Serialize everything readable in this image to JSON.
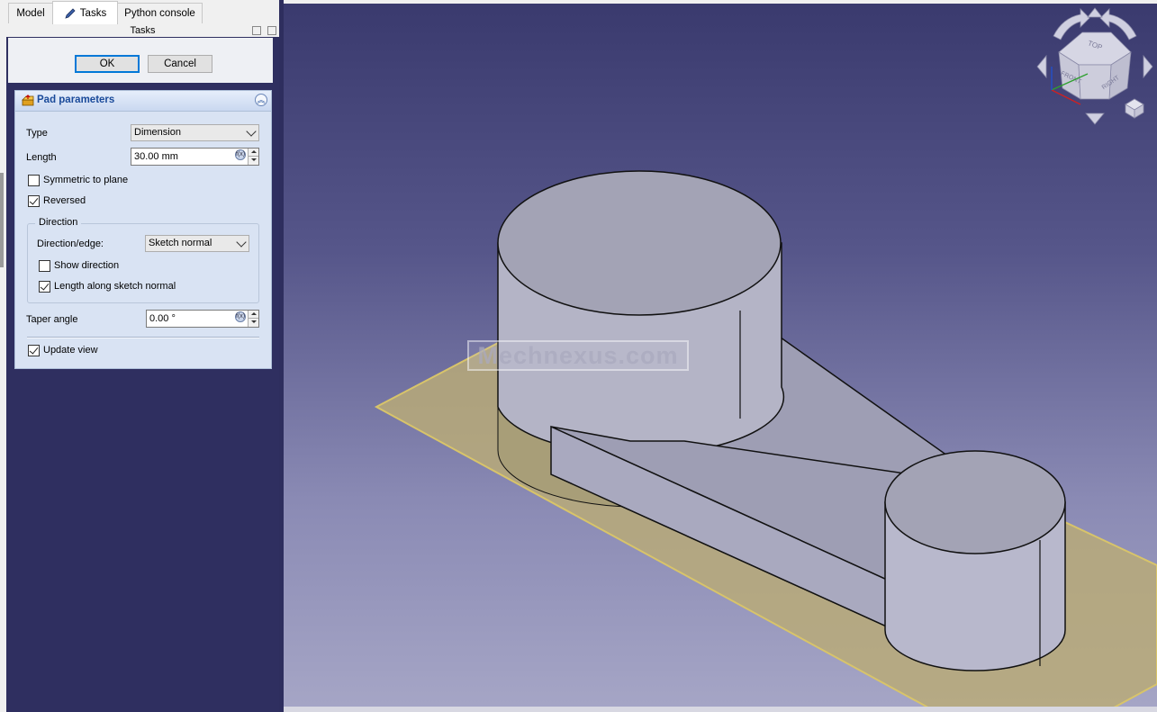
{
  "tabs": [
    {
      "label": "Model",
      "active": false
    },
    {
      "label": "Tasks",
      "active": true,
      "icon": "pencil-icon"
    },
    {
      "label": "Python console",
      "active": false
    }
  ],
  "panel_title": "Tasks",
  "buttons": {
    "ok": "OK",
    "cancel": "Cancel"
  },
  "pad": {
    "title": "Pad parameters",
    "type_label": "Type",
    "type_value": "Dimension",
    "length_label": "Length",
    "length_value": "30.00 mm",
    "symmetric_label": "Symmetric to plane",
    "symmetric_checked": false,
    "reversed_label": "Reversed",
    "reversed_checked": true,
    "direction_group": "Direction",
    "direction_edge_label": "Direction/edge:",
    "direction_edge_value": "Sketch normal",
    "show_direction_label": "Show direction",
    "show_direction_checked": false,
    "length_along_label": "Length along sketch normal",
    "length_along_checked": true,
    "taper_label": "Taper angle",
    "taper_value": "0.00 °",
    "update_view_label": "Update view",
    "update_view_checked": true
  },
  "navcube": {
    "top": "TOP",
    "front": "FRONT",
    "right": "RIGHT"
  },
  "watermark": "Mechnexus.com",
  "colors": {
    "viewport_top": "#3a3a6e",
    "viewport_bottom": "#a6a6c6",
    "sketch_plane": "#d8c98a",
    "solid": "#b8b8c8",
    "left_panel": "#2e2e5e"
  }
}
